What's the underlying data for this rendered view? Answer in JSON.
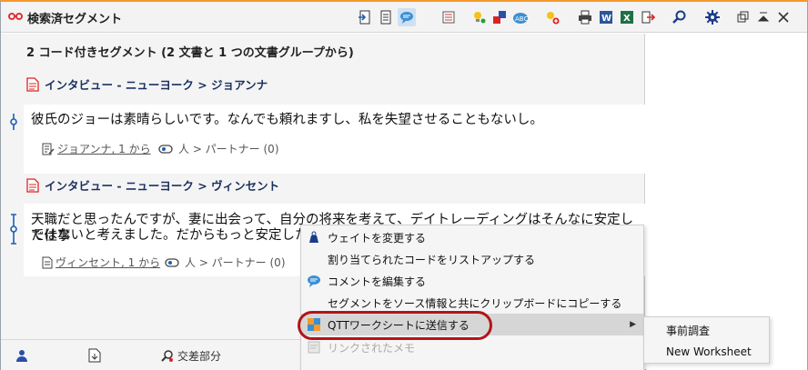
{
  "window": {
    "title": "検索済セグメント",
    "accent_color": "#f39a2b"
  },
  "toolbar": {
    "icons": [
      "retrieve-segments-icon",
      "list-view-icon",
      "comment-view-icon",
      "filter-icon",
      "code-lightbulb-icon",
      "color-code-icon",
      "spellcheck-abc-icon",
      "code-add-icon",
      "print-icon",
      "word-export-icon",
      "excel-export-icon",
      "export-icon",
      "search-icon",
      "settings-gear-icon",
      "restore-window-icon",
      "collapse-icon",
      "close-icon"
    ]
  },
  "main": {
    "summary": "2 コード付きセグメント (2 文書と 1 つの文書グループから)",
    "segments": [
      {
        "doc_header": "インタビュー - ニューヨーク > ジョアンナ",
        "text": "彼氏のジョーは素晴らしいです。なんでも頼れますし、私を失望させることもないし。",
        "source_link": "ジョアンナ, 1 から",
        "code_path": "人 > パートナー (0)"
      },
      {
        "doc_header": "インタビュー - ニューヨーク > ヴィンセント",
        "text_line1": "天職だと思ったんですが、妻に出会って、自分の将来を考えて、デイトレーディングはそんなに安定した仕事",
        "text_line2": "ではないと考えました。だからもっと安定した仕事",
        "source_link": "ヴィンセント, 1 から",
        "code_path": "人 > パートナー (0)"
      }
    ]
  },
  "bottombar": {
    "intersection_label": "交差部分"
  },
  "context_menu": {
    "items": [
      {
        "label": "ウェイトを変更する",
        "icon": "weight-icon"
      },
      {
        "label": "割り当てられたコードをリストアップする",
        "icon": ""
      },
      {
        "label": "コメントを編集する",
        "icon": "comment-icon"
      },
      {
        "label": "セグメントをソース情報と共にクリップボードにコピーする",
        "icon": ""
      },
      {
        "label": "QTTワークシートに送信する",
        "icon": "qtt-worksheet-icon",
        "highlighted": true,
        "has_submenu": true
      },
      {
        "label": "リンクされたメモ",
        "icon": "linked-memo-icon",
        "disabled": true
      }
    ],
    "highlight_color": "#b3141a"
  },
  "submenu": {
    "items": [
      "事前調査",
      "New Worksheet"
    ]
  }
}
